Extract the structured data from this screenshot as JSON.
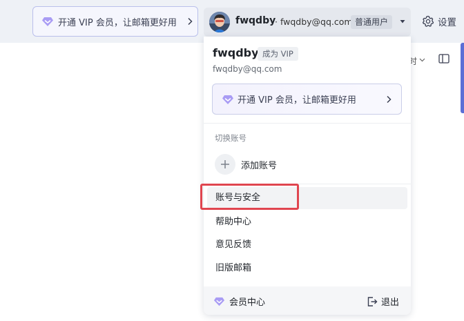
{
  "topbar": {
    "vip_promo": "开通 VIP 会员，让邮箱更好用",
    "account": {
      "name": "fwqdby",
      "email": "· fwqdby@qq.com",
      "badge": "普通用户"
    },
    "settings_label": "设置",
    "behind_text": "时"
  },
  "dropdown": {
    "name": "fwqdby",
    "become_vip": "成为 VIP",
    "email": "fwqdby@qq.com",
    "vip_promo": "开通 VIP 会员，让邮箱更好用",
    "switch_account_heading": "切换账号",
    "add_account": "添加账号",
    "menu_items": [
      "账号与安全",
      "帮助中心",
      "意见反馈",
      "旧版邮箱"
    ],
    "footer": {
      "member_center": "会员中心",
      "logout": "退出"
    }
  },
  "colors": {
    "accent": "#8b7cf0",
    "highlight_border": "#e0454f",
    "topbar_bg": "#eef1f6"
  },
  "icons": [
    "diamond-icon",
    "chevron-right-icon",
    "caret-down-icon",
    "gear-icon",
    "plus-icon",
    "logout-icon",
    "layout-icon"
  ]
}
